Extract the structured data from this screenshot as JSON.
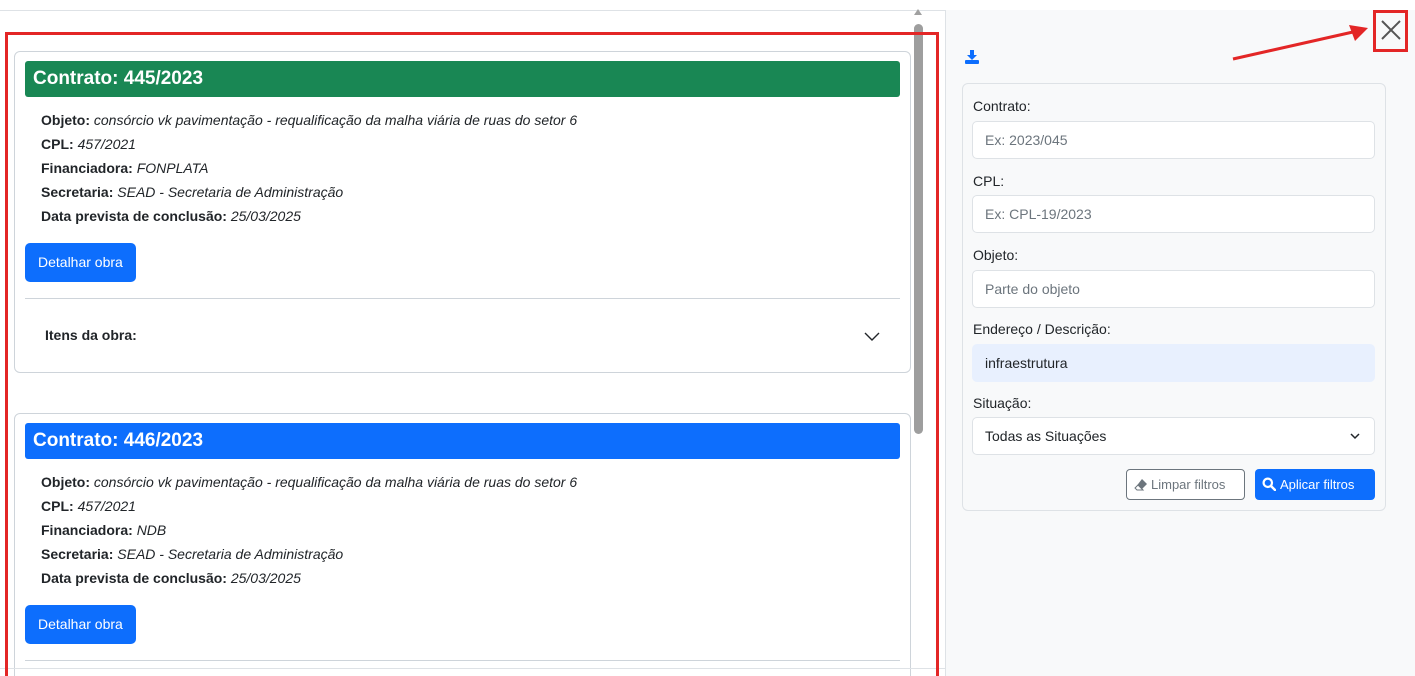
{
  "cards": [
    {
      "header": "Contrato: 445/2023",
      "header_color": "#198754",
      "fields": [
        {
          "label": "Objeto:",
          "value": "consórcio vk pavimentação - requalificação da malha viária de ruas do setor 6"
        },
        {
          "label": "CPL:",
          "value": "457/2021"
        },
        {
          "label": "Financiadora:",
          "value": "FONPLATA"
        },
        {
          "label": "Secretaria:",
          "value": "SEAD - Secretaria de Administração"
        },
        {
          "label": "Data prevista de conclusão:",
          "value": "25/03/2025"
        }
      ],
      "button": "Detalhar obra",
      "items_label": "Itens da obra:"
    },
    {
      "header": "Contrato: 446/2023",
      "header_color": "#0d6efd",
      "fields": [
        {
          "label": "Objeto:",
          "value": "consórcio vk pavimentação - requalificação da malha viária de ruas do setor 6"
        },
        {
          "label": "CPL:",
          "value": "457/2021"
        },
        {
          "label": "Financiadora:",
          "value": "NDB"
        },
        {
          "label": "Secretaria:",
          "value": "SEAD - Secretaria de Administração"
        },
        {
          "label": "Data prevista de conclusão:",
          "value": "25/03/2025"
        }
      ],
      "button": "Detalhar obra"
    }
  ],
  "filters": {
    "contrato": {
      "label": "Contrato:",
      "placeholder": "Ex: 2023/045"
    },
    "cpl": {
      "label": "CPL:",
      "placeholder": "Ex: CPL-19/2023"
    },
    "objeto": {
      "label": "Objeto:",
      "placeholder": "Parte do objeto"
    },
    "endereco": {
      "label": "Endereço / Descrição:",
      "value": "infraestrutura"
    },
    "situacao": {
      "label": "Situação:",
      "selected": "Todas as Situações"
    },
    "clear_label": "Limpar filtros",
    "apply_label": "Aplicar filtros"
  },
  "icons": {
    "download": "download-icon",
    "close": "close-icon",
    "eraser": "eraser-icon",
    "search": "search-icon",
    "chevron": "chevron-down-icon"
  },
  "colors": {
    "primary": "#0d6efd",
    "success": "#198754",
    "annotation": "#e32626"
  }
}
